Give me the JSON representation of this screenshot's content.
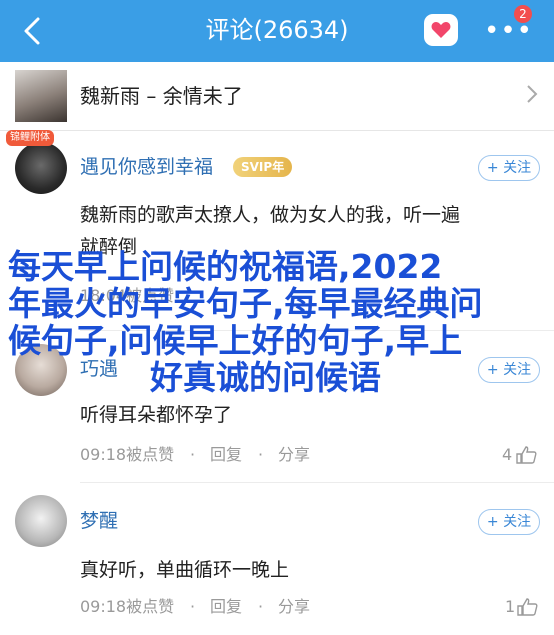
{
  "header": {
    "title": "评论(26634)",
    "badge_count": "2",
    "more_label": "•••"
  },
  "song": {
    "title": "魏新雨 – 余情未了"
  },
  "comments": [
    {
      "user": "遇见你感到幸福",
      "vip": "SVIP年",
      "avatar_tag": "锦鲤附体",
      "follow": "+ 关注",
      "text_line1": "魏新雨的歌声太撩人，做为女人的我，听一遍",
      "text_line2": "就醉倒",
      "meta": "18:04被点赞",
      "likes": ""
    },
    {
      "user": "巧遇",
      "follow": "+ 关注",
      "text": "听得耳朵都怀孕了",
      "time": "09:18被点赞",
      "reply": "回复",
      "share": "分享",
      "likes": "4"
    },
    {
      "user": "梦醒",
      "follow": "+ 关注",
      "text": "真好听，单曲循环一晚上",
      "time": "09:18被点赞",
      "reply": "回复",
      "share": "分享",
      "likes": "1"
    }
  ],
  "overlay": {
    "line1": "每天早上问候的祝福语,2022",
    "line2": "年最火的早安句子,每早最经典问",
    "line3": "候句子,问候早上好的句子,早上",
    "line4": "好真诚的问候语"
  },
  "colors": {
    "header_bg": "#3a9ee6",
    "username": "#2f6fb3",
    "overlay_text": "#1a4fd6"
  },
  "icons": [
    "back-arrow-icon",
    "heart-message-icon",
    "more-icon",
    "chevron-right-icon",
    "like-icon"
  ]
}
